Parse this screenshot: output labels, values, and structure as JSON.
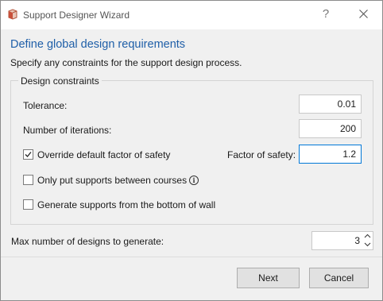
{
  "window": {
    "title": "Support Designer Wizard",
    "help_label": "?",
    "icon": "wall-icon",
    "accent_color": "#1f5fa8",
    "focus_color": "#0078d7"
  },
  "header": {
    "title": "Define global design requirements",
    "subtitle": "Specify any constraints for the support design process."
  },
  "constraints": {
    "group_title": "Design constraints",
    "tolerance": {
      "label": "Tolerance:",
      "value": "0.01"
    },
    "iterations": {
      "label": "Number of iterations:",
      "value": "200"
    },
    "override_safety": {
      "label": "Override default factor of safety",
      "checked": true
    },
    "factor_of_safety": {
      "label": "Factor of safety:",
      "value": "1.2"
    },
    "only_between_courses": {
      "label": "Only put supports between courses",
      "checked": false,
      "info_icon": "info-icon"
    },
    "generate_from_bottom": {
      "label": "Generate supports from the bottom of wall",
      "checked": false
    }
  },
  "max_designs": {
    "label": "Max number of designs to generate:",
    "value": "3"
  },
  "buttons": {
    "next": "Next",
    "cancel": "Cancel"
  }
}
